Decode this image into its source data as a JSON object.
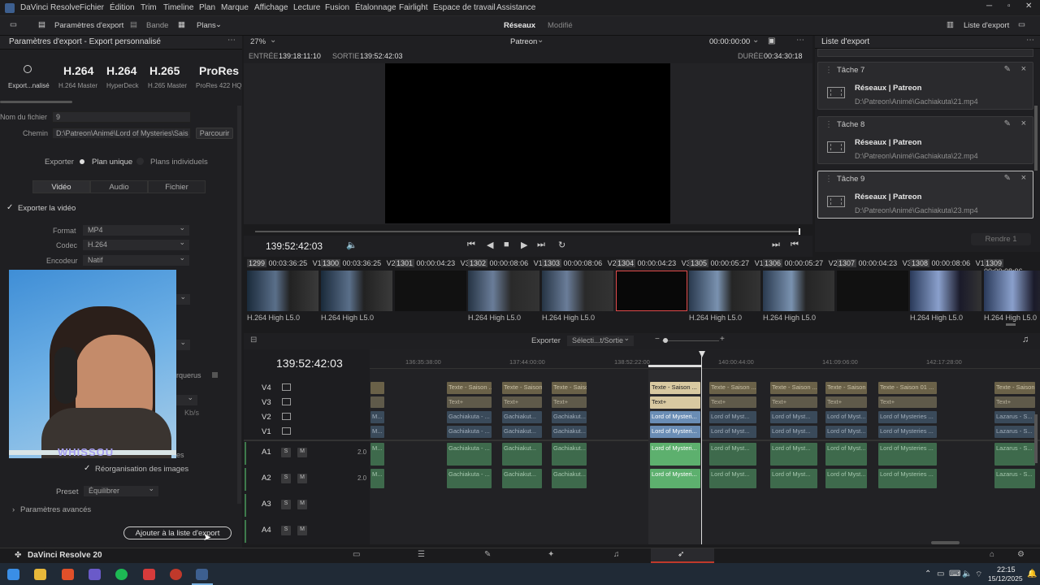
{
  "app": {
    "name": "DaVinci Resolve",
    "menu": [
      "Fichier",
      "Édition",
      "Trim",
      "Timeline",
      "Plan",
      "Marque",
      "Affichage",
      "Lecture",
      "Fusion",
      "Étalonnage",
      "Fairlight",
      "Espace de travail",
      "Assistance"
    ]
  },
  "toolbar": {
    "export_params": "Paramètres d'export",
    "bande": "Bande",
    "plans": "Plans",
    "project": "Réseaux",
    "modified": "Modifié",
    "queue": "Liste d'export"
  },
  "left": {
    "header": "Paramètres d'export - Export personnalisé",
    "presets": [
      {
        "big": "H.264",
        "small": "H.264 Master"
      },
      {
        "big": "H.264",
        "small": "HyperDeck"
      },
      {
        "big": "H.265",
        "small": "H.265 Master"
      },
      {
        "big": "ProRes",
        "small": "ProRes 422 HQ"
      }
    ],
    "custom_label": "Export...nalisé",
    "filename_label": "Nom du fichier",
    "filename": "9",
    "path_label": "Chemin",
    "path": "D:\\Patreon\\Animé\\Lord of Mysteries\\Sais",
    "browse": "Parcourir",
    "export_label": "Exporter",
    "single": "Plan unique",
    "individual": "Plans individuels",
    "tabs": [
      "Vidéo",
      "Audio",
      "Fichier"
    ],
    "export_video": "Exporter la vidéo",
    "format_label": "Format",
    "format": "MP4",
    "codec_label": "Codec",
    "codec": "H.264",
    "encoder_label": "Encodeur",
    "encoder": "Natif",
    "partial_markers": "rquerus",
    "partial_kbs": "Kb/s",
    "partial_es": "es",
    "reorg": "Réorganisation des images",
    "preset_label": "Preset",
    "preset": "Équilibrer",
    "advanced": "Paramètres avancés",
    "add_button": "Ajouter à la liste d'export",
    "webcam_name": "WHISSOU"
  },
  "viewer": {
    "zoom": "27%",
    "timeline": "Patreon",
    "tc": "00:00:00:00",
    "in_label": "ENTRÉE",
    "in": "139:18:11:10",
    "out_label": "SORTIE",
    "out": "139:52:42:03",
    "dur_label": "DURÉE",
    "dur": "00:34:30:18",
    "current": "139:52:42:03"
  },
  "clips": [
    {
      "n": "1299",
      "tc": "00:03:36:25",
      "v": "V1",
      "label": "H.264 High L5.0"
    },
    {
      "n": "1300",
      "tc": "00:03:36:25",
      "v": "V2",
      "label": "H.264 High L5.0"
    },
    {
      "n": "1301",
      "tc": "00:00:04:23",
      "v": "V3",
      "label": ""
    },
    {
      "n": "1302",
      "tc": "00:00:08:06",
      "v": "V1",
      "label": "H.264 High L5.0"
    },
    {
      "n": "1303",
      "tc": "00:00:08:06",
      "v": "V2",
      "label": "H.264 High L5.0"
    },
    {
      "n": "1304",
      "tc": "00:00:04:23",
      "v": "V3",
      "label": ""
    },
    {
      "n": "1305",
      "tc": "00:00:05:27",
      "v": "V1",
      "label": "H.264 High L5.0"
    },
    {
      "n": "1306",
      "tc": "00:00:05:27",
      "v": "V2",
      "label": "H.264 High L5.0"
    },
    {
      "n": "1307",
      "tc": "00:00:04:23",
      "v": "V3",
      "label": ""
    },
    {
      "n": "1308",
      "tc": "00:00:08:06",
      "v": "V1",
      "label": "H.264 High L5.0"
    },
    {
      "n": "1309",
      "tc": "00:00:08:06",
      "v": "",
      "label": "H.264 High L5.0"
    }
  ],
  "timeline": {
    "exporter": "Exporter",
    "selection": "Sélecti...t/Sortie",
    "tc": "139:52:42:03",
    "ruler": [
      "136:35:38:00",
      "137:44:00:00",
      "138:52:22:00",
      "140:00:44:00",
      "141:09:06:00",
      "142:17:28:00"
    ],
    "tracks": [
      "V4",
      "V3",
      "V2",
      "V1",
      "A1",
      "A2",
      "A3",
      "A4"
    ],
    "vol": "2.0",
    "clip_texts": {
      "t4": "Texte - Saison ...",
      "t4sel": "Texte - Saison ...",
      "t4b": "Texte - Saison 01 ...",
      "t3": "Text+",
      "gach": "Gachiakuta - ...",
      "gach2": "Gachiakut...",
      "lord": "Lord of Mysteri...",
      "lord2": "Lord of Myst...",
      "lord3": "Lord of Mysteries ...",
      "laz": "Lazarus - S...",
      "m": "M..."
    }
  },
  "queue": {
    "header": "Liste d'export",
    "tasks": [
      {
        "name": "Tâche 7",
        "title": "Réseaux | Patreon",
        "path": "D:\\Patreon\\Animé\\Gachiakuta\\21.mp4"
      },
      {
        "name": "Tâche 8",
        "title": "Réseaux | Patreon",
        "path": "D:\\Patreon\\Animé\\Gachiakuta\\22.mp4"
      },
      {
        "name": "Tâche 9",
        "title": "Réseaux | Patreon",
        "path": "D:\\Patreon\\Animé\\Gachiakuta\\23.mp4"
      }
    ],
    "render": "Rendre 1"
  },
  "bottom": {
    "app": "DaVinci Resolve 20"
  },
  "taskbar": {
    "time": "22:15",
    "date": "15/12/2025"
  }
}
